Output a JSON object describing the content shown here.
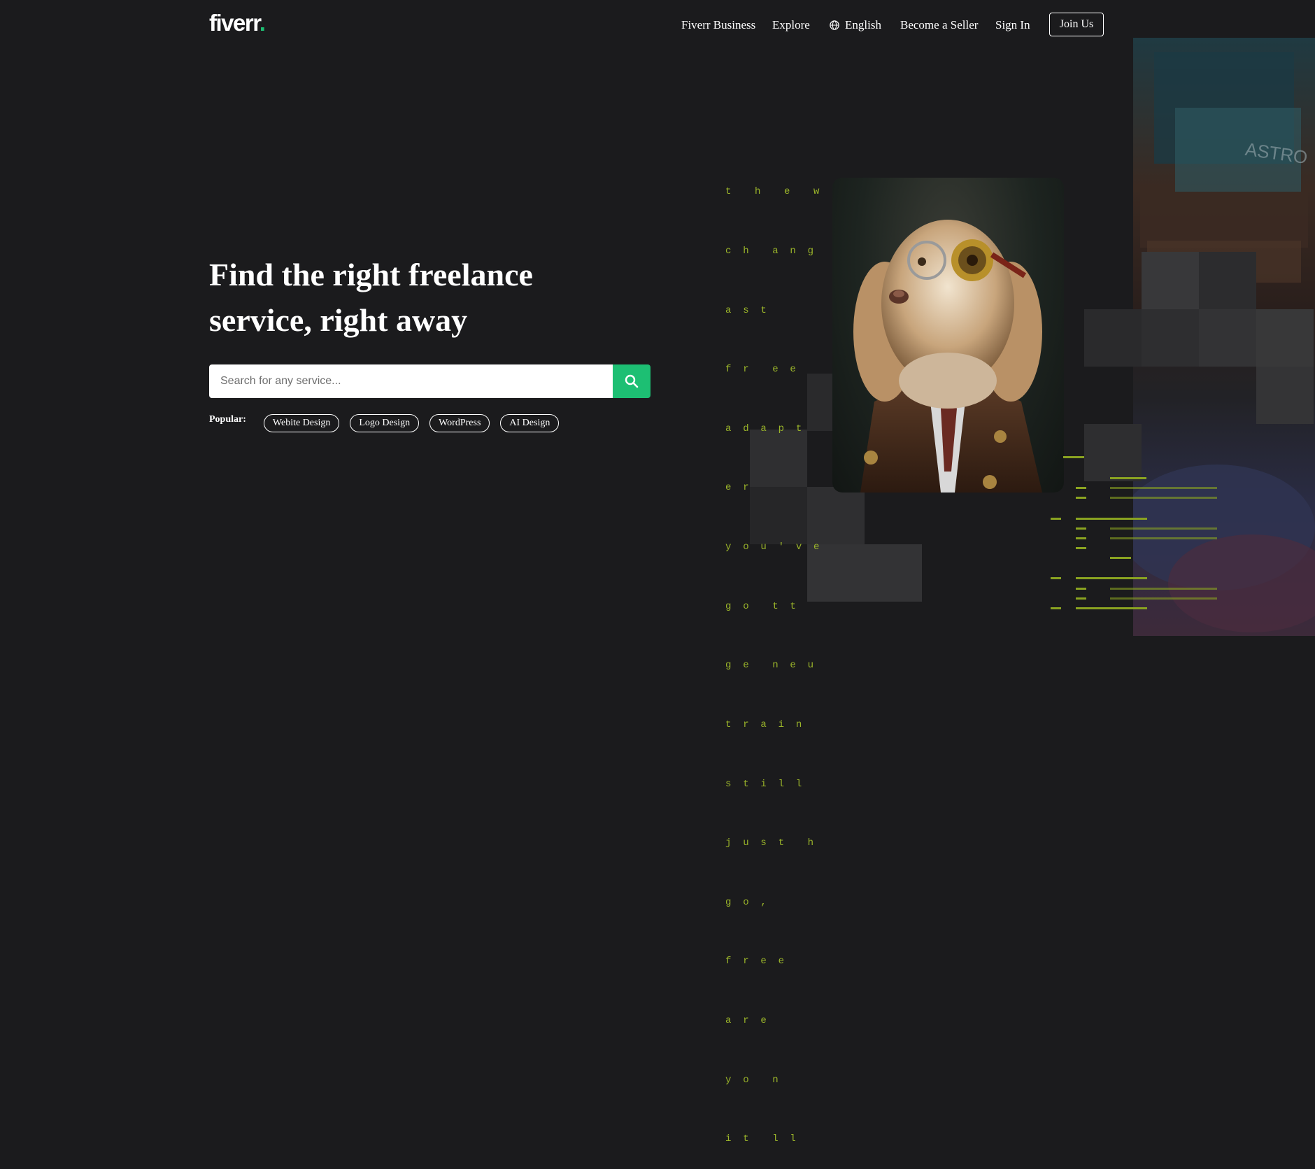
{
  "brand": {
    "name": "fiverr",
    "dot": ".",
    "accent_color": "#1dbf73"
  },
  "nav": {
    "items": [
      {
        "label": "Fiverr Business"
      },
      {
        "label": "Explore"
      },
      {
        "label": "English",
        "icon": "globe-icon"
      },
      {
        "label": "Become a Seller"
      },
      {
        "label": "Sign In"
      }
    ],
    "join_label": "Join Us"
  },
  "hero": {
    "title": "Find the right freelance service, right away",
    "search": {
      "placeholder": "Search for any service...",
      "button_icon": "search-icon"
    },
    "popular_label": "Popular:",
    "popular_tags": [
      "Webite Design",
      "Logo Design",
      "WordPress",
      "AI Design"
    ]
  },
  "art": {
    "matrix_lines": [
      "t    h    e    w    o    r  l  d    i  s",
      "c  h    a  n  g    i  n  g  .    f",
      "a  s  t",
      "f  r    e  e",
      "a  d  a  p  t",
      "e  r",
      "y  o  u  '  v  e",
      "g  o    t  t",
      "g  e    n  e  u",
      "t  r  a  i  n",
      "s  t  i  l  l",
      "j  u  s  t    h",
      "g  o  ,",
      "f  r  e  e",
      "a  r  e",
      "y  o    n",
      "i  t    l  l"
    ],
    "matrix_color": "#9bb52a",
    "city_sign": "ASTRO"
  }
}
